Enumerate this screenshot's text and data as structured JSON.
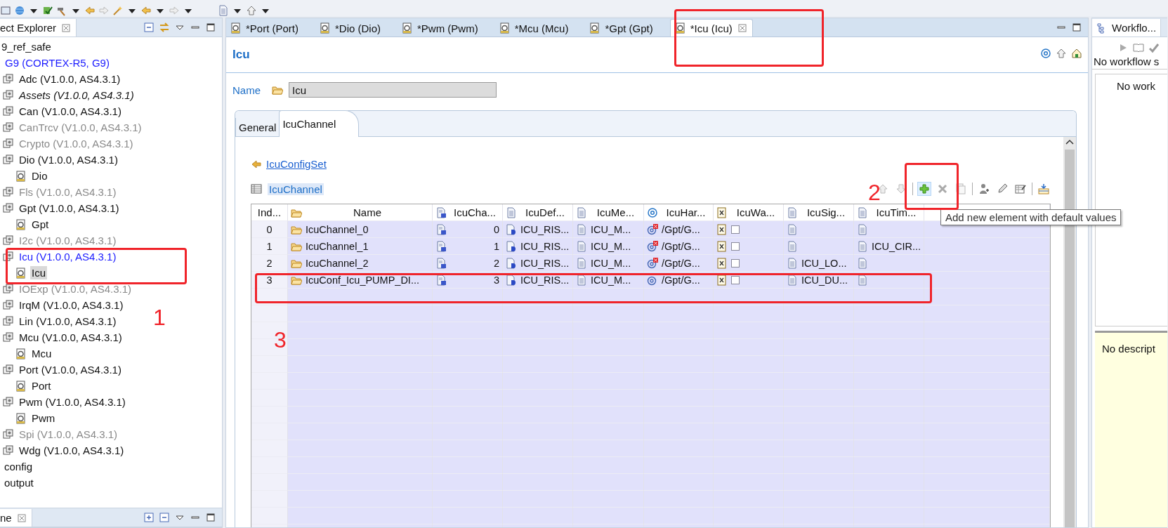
{
  "project_explorer": {
    "title": "ect Explorer",
    "tree": [
      {
        "label": "9_ref_safe",
        "kind": "project",
        "disabled": false,
        "active": false,
        "selected": false
      },
      {
        "label": "G9 (CORTEX-R5, G9)",
        "kind": "target",
        "disabled": false,
        "active": true,
        "selected": false
      },
      {
        "label": "Adc (V1.0.0, AS4.3.1)",
        "kind": "module",
        "disabled": false,
        "active": false,
        "selected": false
      },
      {
        "label": "Assets (V1.0.0, AS4.3.1)",
        "kind": "assets",
        "disabled": false,
        "active": false,
        "selected": false
      },
      {
        "label": "Can (V1.0.0, AS4.3.1)",
        "kind": "module",
        "disabled": false,
        "active": false,
        "selected": false
      },
      {
        "label": "CanTrcv (V1.0.0, AS4.3.1)",
        "kind": "module",
        "disabled": true,
        "active": false,
        "selected": false
      },
      {
        "label": "Crypto (V1.0.0, AS4.3.1)",
        "kind": "module",
        "disabled": true,
        "active": false,
        "selected": false
      },
      {
        "label": "Dio (V1.0.0, AS4.3.1)",
        "kind": "module",
        "disabled": false,
        "active": false,
        "selected": false,
        "children": [
          {
            "label": "Dio",
            "kind": "config",
            "disabled": false,
            "active": false,
            "selected": false
          }
        ]
      },
      {
        "label": "Fls (V1.0.0, AS4.3.1)",
        "kind": "module",
        "disabled": true,
        "active": false,
        "selected": false
      },
      {
        "label": "Gpt (V1.0.0, AS4.3.1)",
        "kind": "module",
        "disabled": false,
        "active": false,
        "selected": false,
        "children": [
          {
            "label": "Gpt",
            "kind": "config",
            "disabled": false,
            "active": false,
            "selected": false
          }
        ]
      },
      {
        "label": "I2c (V1.0.0, AS4.3.1)",
        "kind": "module",
        "disabled": true,
        "active": false,
        "selected": false
      },
      {
        "label": "Icu (V1.0.0, AS4.3.1)",
        "kind": "module",
        "disabled": false,
        "active": true,
        "selected": false,
        "children": [
          {
            "label": "Icu",
            "kind": "config",
            "disabled": false,
            "active": false,
            "selected": true
          }
        ]
      },
      {
        "label": "IOExp (V1.0.0, AS4.3.1)",
        "kind": "module",
        "disabled": true,
        "active": false,
        "selected": false
      },
      {
        "label": "IrqM (V1.0.0, AS4.3.1)",
        "kind": "module",
        "disabled": false,
        "active": false,
        "selected": false
      },
      {
        "label": "Lin (V1.0.0, AS4.3.1)",
        "kind": "module",
        "disabled": false,
        "active": false,
        "selected": false
      },
      {
        "label": "Mcu (V1.0.0, AS4.3.1)",
        "kind": "module",
        "disabled": false,
        "active": false,
        "selected": false,
        "children": [
          {
            "label": "Mcu",
            "kind": "config",
            "disabled": false,
            "active": false,
            "selected": false
          }
        ]
      },
      {
        "label": "Port (V1.0.0, AS4.3.1)",
        "kind": "module",
        "disabled": false,
        "active": false,
        "selected": false,
        "children": [
          {
            "label": "Port",
            "kind": "config",
            "disabled": false,
            "active": false,
            "selected": false
          }
        ]
      },
      {
        "label": "Pwm (V1.0.0, AS4.3.1)",
        "kind": "module",
        "disabled": false,
        "active": false,
        "selected": false,
        "children": [
          {
            "label": "Pwm",
            "kind": "config",
            "disabled": false,
            "active": false,
            "selected": false
          }
        ]
      },
      {
        "label": "Spi (V1.0.0, AS4.3.1)",
        "kind": "module",
        "disabled": true,
        "active": false,
        "selected": false
      },
      {
        "label": "Wdg (V1.0.0, AS4.3.1)",
        "kind": "module",
        "disabled": false,
        "active": false,
        "selected": false
      },
      {
        "label": "config",
        "kind": "folder",
        "disabled": false,
        "active": false,
        "selected": false
      },
      {
        "label": "output",
        "kind": "folder",
        "disabled": false,
        "active": false,
        "selected": false
      }
    ]
  },
  "outline_panel": {
    "title": "ne"
  },
  "editor_tabs": [
    {
      "label": "*Port (Port)",
      "selected": false
    },
    {
      "label": "*Dio (Dio)",
      "selected": false
    },
    {
      "label": "*Pwm (Pwm)",
      "selected": false
    },
    {
      "label": "*Mcu (Mcu)",
      "selected": false
    },
    {
      "label": "*Gpt (Gpt)",
      "selected": false
    },
    {
      "label": "*Icu (Icu)",
      "selected": true
    }
  ],
  "editor": {
    "title": "Icu",
    "name_label": "Name",
    "name_value": "Icu",
    "sub_tabs": [
      {
        "label": "General",
        "selected": false
      },
      {
        "label": "IcuChannel",
        "selected": true
      }
    ],
    "config_set_link": "IcuConfigSet",
    "table_title": "IcuChannel",
    "tooltip": "Add new element with default values",
    "table": {
      "columns": [
        {
          "label": "Ind...",
          "kind": "index"
        },
        {
          "label": "Name",
          "kind": "folder"
        },
        {
          "label": "IcuCha...",
          "kind": "number"
        },
        {
          "label": "IcuDef...",
          "kind": "text"
        },
        {
          "label": "IcuMe...",
          "kind": "text"
        },
        {
          "label": "IcuHar...",
          "kind": "ref"
        },
        {
          "label": "IcuWa...",
          "kind": "bool"
        },
        {
          "label": "IcuSig...",
          "kind": "text"
        },
        {
          "label": "IcuTim...",
          "kind": "text"
        }
      ],
      "rows": [
        {
          "cells": [
            {
              "kind": "index",
              "text": "0"
            },
            {
              "kind": "name",
              "text": "IcuChannel_0"
            },
            {
              "kind": "number",
              "text": "0"
            },
            {
              "kind": "enum",
              "text": "ICU_RIS..."
            },
            {
              "kind": "text",
              "text": "ICU_M..."
            },
            {
              "kind": "ref",
              "text": "/Gpt/G...",
              "error": true
            },
            {
              "kind": "bool",
              "checked": false
            },
            {
              "kind": "text"
            },
            {
              "kind": "text"
            }
          ]
        },
        {
          "cells": [
            {
              "kind": "index",
              "text": "1"
            },
            {
              "kind": "name",
              "text": "IcuChannel_1"
            },
            {
              "kind": "number",
              "text": "1"
            },
            {
              "kind": "enum",
              "text": "ICU_RIS..."
            },
            {
              "kind": "text",
              "text": "ICU_M..."
            },
            {
              "kind": "ref",
              "text": "/Gpt/G...",
              "error": true
            },
            {
              "kind": "bool",
              "checked": false
            },
            {
              "kind": "text"
            },
            {
              "kind": "text",
              "text": "ICU_CIR..."
            }
          ]
        },
        {
          "cells": [
            {
              "kind": "index",
              "text": "2"
            },
            {
              "kind": "name",
              "text": "IcuChannel_2"
            },
            {
              "kind": "number",
              "text": "2"
            },
            {
              "kind": "enum",
              "text": "ICU_RIS..."
            },
            {
              "kind": "text",
              "text": "ICU_M..."
            },
            {
              "kind": "ref",
              "text": "/Gpt/G...",
              "error": true
            },
            {
              "kind": "bool",
              "checked": false
            },
            {
              "kind": "text",
              "text": "ICU_LO..."
            },
            {
              "kind": "text"
            }
          ]
        },
        {
          "cells": [
            {
              "kind": "index",
              "text": "3"
            },
            {
              "kind": "name",
              "text": "IcuConf_Icu_PUMP_DI..."
            },
            {
              "kind": "number",
              "text": "3"
            },
            {
              "kind": "enum",
              "text": "ICU_RIS..."
            },
            {
              "kind": "text",
              "text": "ICU_M..."
            },
            {
              "kind": "ref",
              "text": "/Gpt/G...",
              "error": false
            },
            {
              "kind": "bool",
              "checked": false
            },
            {
              "kind": "text",
              "text": "ICU_DU..."
            },
            {
              "kind": "text"
            }
          ]
        }
      ]
    }
  },
  "workflow_panel": {
    "title": "Workflo...",
    "status": "No workflow s",
    "list_text": "No work",
    "description": "No descript"
  },
  "annotations": [
    {
      "kind": "box"
    },
    {
      "kind": "box"
    },
    {
      "kind": "box"
    },
    {
      "kind": "box"
    },
    {
      "kind": "number",
      "text": "1"
    },
    {
      "kind": "number",
      "text": "2"
    },
    {
      "kind": "number",
      "text": "3"
    }
  ]
}
